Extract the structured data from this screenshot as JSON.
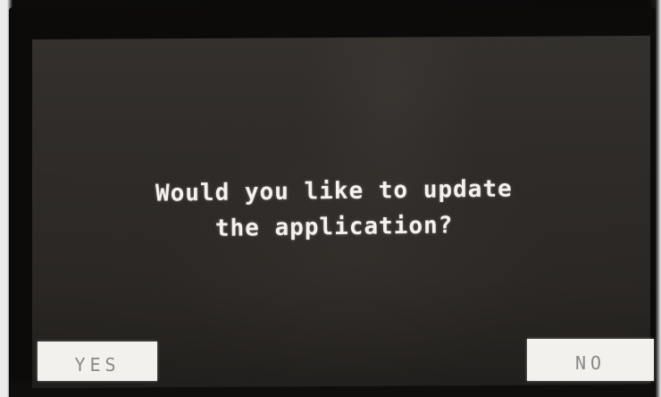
{
  "dialog": {
    "message_lines": [
      "Would you like to update",
      "the application?"
    ],
    "yes_label": "YES",
    "no_label": "NO"
  },
  "colors": {
    "screen_background": "#2e2b28",
    "text": "#f4f1ee",
    "button_background": "#f3f1ee",
    "button_text": "#8a8786"
  }
}
